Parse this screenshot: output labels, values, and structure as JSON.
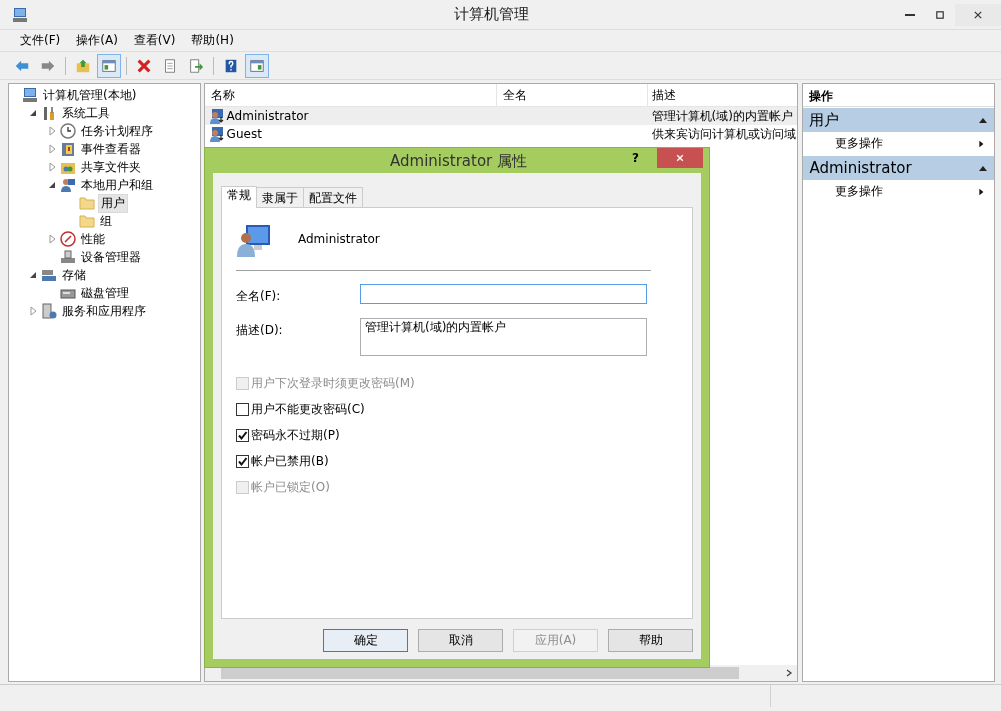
{
  "window": {
    "title": "计算机管理"
  },
  "menu": [
    "文件(F)",
    "操作(A)",
    "查看(V)",
    "帮助(H)"
  ],
  "toolbar": [
    {
      "kind": "back"
    },
    {
      "kind": "forward"
    },
    {
      "kind": "sep"
    },
    {
      "kind": "up"
    },
    {
      "kind": "tree",
      "on": true
    },
    {
      "kind": "sep"
    },
    {
      "kind": "delete"
    },
    {
      "kind": "properties"
    },
    {
      "kind": "export"
    },
    {
      "kind": "sep"
    },
    {
      "kind": "help"
    },
    {
      "kind": "actionpane",
      "on": true
    }
  ],
  "tree": [
    {
      "label": "计算机管理(本地)",
      "kind": "root",
      "selected": false,
      "children": [
        {
          "label": "系统工具",
          "kind": "branch",
          "expanded": true,
          "selected": false,
          "children": [
            {
              "label": "任务计划程序",
              "kind": "branch",
              "expanded": false,
              "selected": false
            },
            {
              "label": "事件查看器",
              "kind": "branch",
              "expanded": false,
              "selected": false
            },
            {
              "label": "共享文件夹",
              "kind": "branch",
              "expanded": false,
              "selected": false
            },
            {
              "label": "本地用户和组",
              "kind": "branch",
              "expanded": true,
              "selected": false,
              "children": [
                {
                  "label": "用户",
                  "kind": "leaf",
                  "selected": true
                },
                {
                  "label": "组",
                  "kind": "leaf",
                  "selected": false
                }
              ]
            },
            {
              "label": "性能",
              "kind": "branch",
              "expanded": false,
              "selected": false
            },
            {
              "label": "设备管理器",
              "kind": "leaf",
              "selected": false
            }
          ]
        },
        {
          "label": "存储",
          "kind": "branch",
          "expanded": true,
          "selected": false,
          "children": [
            {
              "label": "磁盘管理",
              "kind": "leaf",
              "selected": false
            }
          ]
        },
        {
          "label": "服务和应用程序",
          "kind": "branch",
          "expanded": false,
          "selected": false
        }
      ]
    }
  ],
  "list": {
    "columns": [
      "名称",
      "全名",
      "描述"
    ],
    "rows": [
      {
        "name": "Administrator",
        "description": "管理计算机(域)的内置帐户",
        "selected": true
      },
      {
        "name": "Guest",
        "description": "供来宾访问计算机或访问域",
        "selected": false
      }
    ]
  },
  "actions": {
    "title": "操作",
    "sections": [
      {
        "title": "用户",
        "expanded": true,
        "items": [
          "更多操作"
        ]
      },
      {
        "title": "Administrator",
        "expanded": true,
        "items": [
          "更多操作"
        ]
      }
    ]
  },
  "dialog": {
    "title": "Administrator 属性",
    "help": "?",
    "tabs": [
      {
        "label": "常规",
        "selected": true
      },
      {
        "label": "隶属于",
        "selected": false
      },
      {
        "label": "配置文件",
        "selected": false
      }
    ],
    "user_name": "Administrator",
    "fields": [
      {
        "label": "全名(F):",
        "focused": true,
        "multiline": false
      },
      {
        "label": "描述(D):",
        "value": "管理计算机(域)的内置帐户",
        "focused": false,
        "multiline": true
      }
    ],
    "checkboxes": [
      {
        "label": "用户下次登录时须更改密码(M)",
        "checked": false,
        "disabled": true
      },
      {
        "label": "用户不能更改密码(C)",
        "checked": false,
        "disabled": false
      },
      {
        "label": "密码永不过期(P)",
        "checked": true,
        "disabled": false
      },
      {
        "label": "帐户已禁用(B)",
        "checked": true,
        "disabled": false
      },
      {
        "label": "帐户已锁定(O)",
        "checked": false,
        "disabled": true
      }
    ],
    "buttons": [
      {
        "label": "确定",
        "default": true,
        "disabled": false
      },
      {
        "label": "取消",
        "default": false,
        "disabled": false
      },
      {
        "label": "应用(A)",
        "default": false,
        "disabled": true
      },
      {
        "label": "帮助",
        "default": false,
        "disabled": false
      }
    ]
  }
}
